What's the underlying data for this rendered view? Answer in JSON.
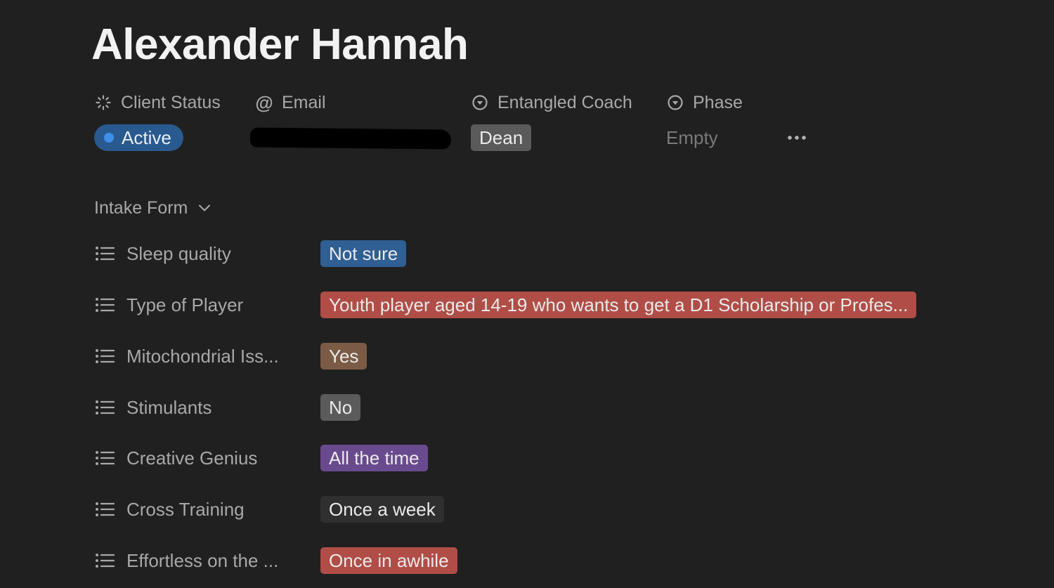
{
  "page": {
    "title": "Alexander Hannah"
  },
  "properties": {
    "client_status": {
      "label": "Client Status",
      "value": "Active",
      "icon": "status-spinner-icon"
    },
    "email": {
      "label": "Email",
      "icon": "at-icon"
    },
    "coach": {
      "label": "Entangled Coach",
      "value": "Dean",
      "icon": "select-circle-icon"
    },
    "phase": {
      "label": "Phase",
      "value": "Empty",
      "icon": "select-circle-icon"
    },
    "more_label": "•••"
  },
  "intake": {
    "section_label": "Intake Form",
    "rows": [
      {
        "label": "Sleep quality",
        "value": "Not sure",
        "color": "#2f5f93"
      },
      {
        "label": "Type of Player",
        "value": "Youth player aged 14-19 who wants to get a D1 Scholarship or Profes...",
        "color": "#b04d47"
      },
      {
        "label": "Mitochondrial Iss...",
        "value": "Yes",
        "color": "#7b5b46"
      },
      {
        "label": "Stimulants",
        "value": "No",
        "color": "#5b5b5b"
      },
      {
        "label": "Creative Genius",
        "value": "All the time",
        "color": "#6a4a8e"
      },
      {
        "label": "Cross Training",
        "value": "Once a week",
        "color": "#2f2f2f"
      },
      {
        "label": "Effortless on the ...",
        "value": "Once in awhile",
        "color": "#b04d47"
      }
    ]
  },
  "colors": {
    "background": "#202020",
    "status_active": "#295a8f",
    "status_dot": "#3f8fe8",
    "coach_tag": "#5a5a5a"
  }
}
